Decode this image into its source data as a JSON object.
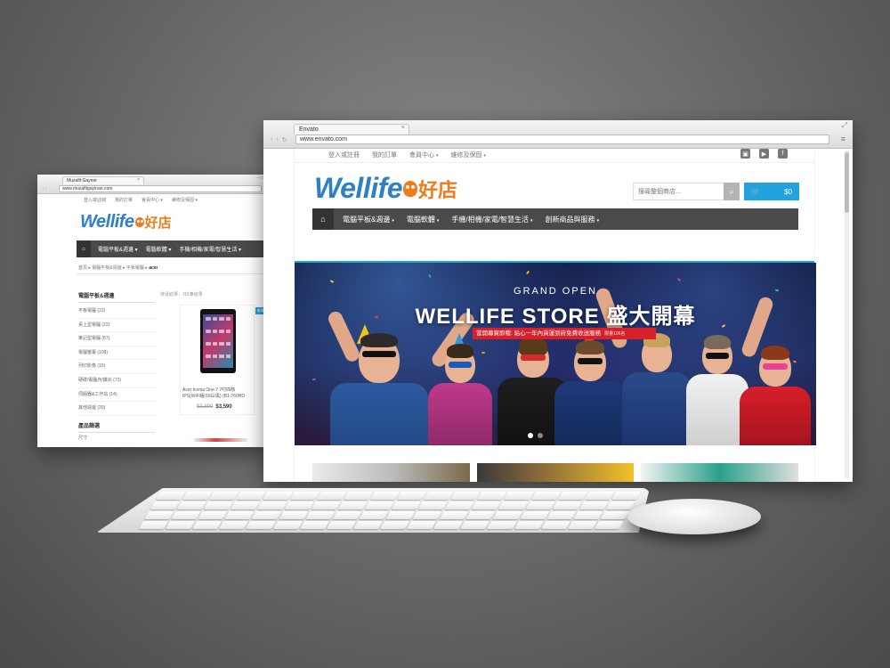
{
  "left_window": {
    "tab_title": "Muzafit Gayner",
    "url": "www.muzafitgayinan.com",
    "top_nav": [
      "登入或註冊",
      "我的訂單",
      "會員中心 ▾",
      "維修及保固 ▾"
    ],
    "logo_text": "Wellife",
    "logo_cn": "好店",
    "main_nav": [
      "電腦平板&週邊 ▾",
      "電腦軟體 ▾",
      "手機/相機/家電/智慧生活 ▾"
    ],
    "breadcrumb": "首頁 ▸ 電腦平板&週邊 ▸ 平板電腦 ▸ ",
    "breadcrumb_current": "acer",
    "sidebar_title": "電腦平板&週邊",
    "categories": [
      "平板電腦 (22)",
      "桌上型電腦 (22)",
      "筆記型電腦 (87)",
      "電腦螢幕 (108)",
      "列印影像 (15)",
      "硬碟/電腦內/擴充 (73)",
      "伺服器&工作站 (14)",
      "其他週邊 (39)"
    ],
    "filter_title": "產品篩選",
    "filter_sub": "尺寸",
    "sort_text": "搜尋結果：共5筆結果",
    "badge": "新貨",
    "product_name": "Acer Iconia One 7 7吋四核 IPS(WiFi版/16G/黑) (B1-760HD",
    "old_price": "$3,890",
    "new_price": "$3,590"
  },
  "right_window": {
    "tab_title": "Envato",
    "url": "www.envato.com",
    "top_nav": [
      "登入或註冊",
      "我的訂單",
      "會員中心",
      "維修及保固"
    ],
    "logo_text": "Wellife",
    "logo_cn": "好店",
    "search_placeholder": "搜尋整個商店...",
    "cart_total": "$0",
    "main_nav": [
      "電腦平板&週邊",
      "電腦軟體",
      "手機/相機/家電/智慧生活",
      "創新商品與服務"
    ],
    "banner": {
      "subtitle": "GRAND OPEN",
      "title": "WELLIFE STORE 盛大開幕",
      "promo": "當開幕賀即贈: 貼心一年內貨運到府免費收送服務",
      "promo_limit": "限量100名"
    }
  },
  "colors": {
    "accent_blue": "#23a3de",
    "brand_orange": "#ef7b1b",
    "logo_blue": "#2d7fc6",
    "nav_dark": "#4a4a4a",
    "promo_red": "#d91f2a"
  }
}
